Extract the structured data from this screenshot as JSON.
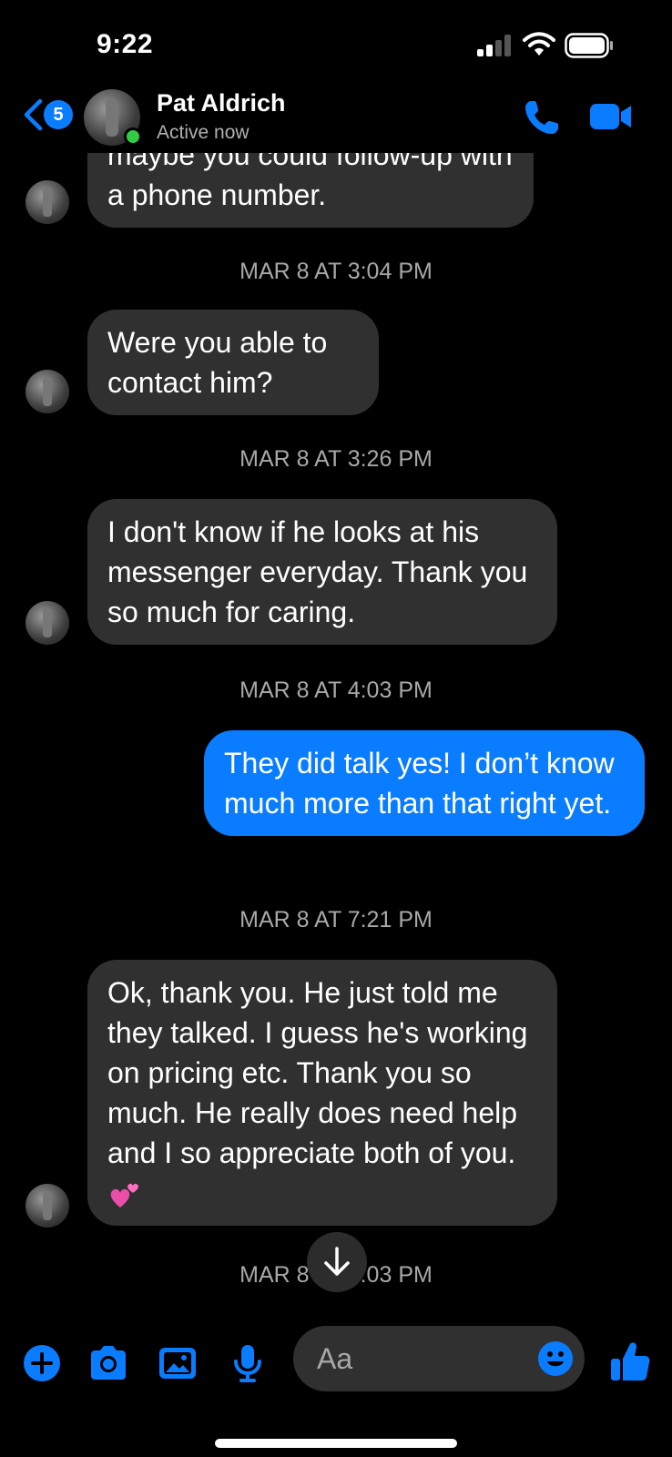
{
  "status_bar": {
    "time": "9:22"
  },
  "header": {
    "back_badge_count": "5",
    "contact_name": "Pat Aldrich",
    "contact_status": "Active now"
  },
  "messages": [
    {
      "type": "incoming",
      "text": "maybe you could follow-up with a phone number."
    },
    {
      "type": "timestamp",
      "text": "MAR 8 AT 3:04 PM"
    },
    {
      "type": "incoming",
      "text": "Were you able to contact him?"
    },
    {
      "type": "timestamp",
      "text": "MAR 8 AT 3:26 PM"
    },
    {
      "type": "incoming",
      "text": "I don't know if he looks at his messenger everyday. Thank you so much for caring."
    },
    {
      "type": "timestamp",
      "text": "MAR 8 AT 4:03 PM"
    },
    {
      "type": "outgoing",
      "text": "They did talk yes! I don’t know much more than that right yet."
    },
    {
      "type": "timestamp",
      "text": "MAR 8 AT 7:21 PM"
    },
    {
      "type": "incoming",
      "text": "Ok,  thank you. He just told me they talked. I guess he's working on pricing etc. Thank you so much. He really does need help and I so appreciate both of you.",
      "emoji": "two-hearts-emoji"
    },
    {
      "type": "timestamp",
      "text": "MAR 8 AT 8:03 PM"
    }
  ],
  "composer": {
    "placeholder": "Aa",
    "icons": [
      "plus-icon",
      "camera-icon",
      "photo-icon",
      "microphone-icon",
      "emoji-icon",
      "thumbs-up-icon"
    ]
  },
  "colors": {
    "accent": "#0a7cff",
    "incoming_bubble": "#303030",
    "background": "#000000",
    "online": "#31cc46"
  }
}
